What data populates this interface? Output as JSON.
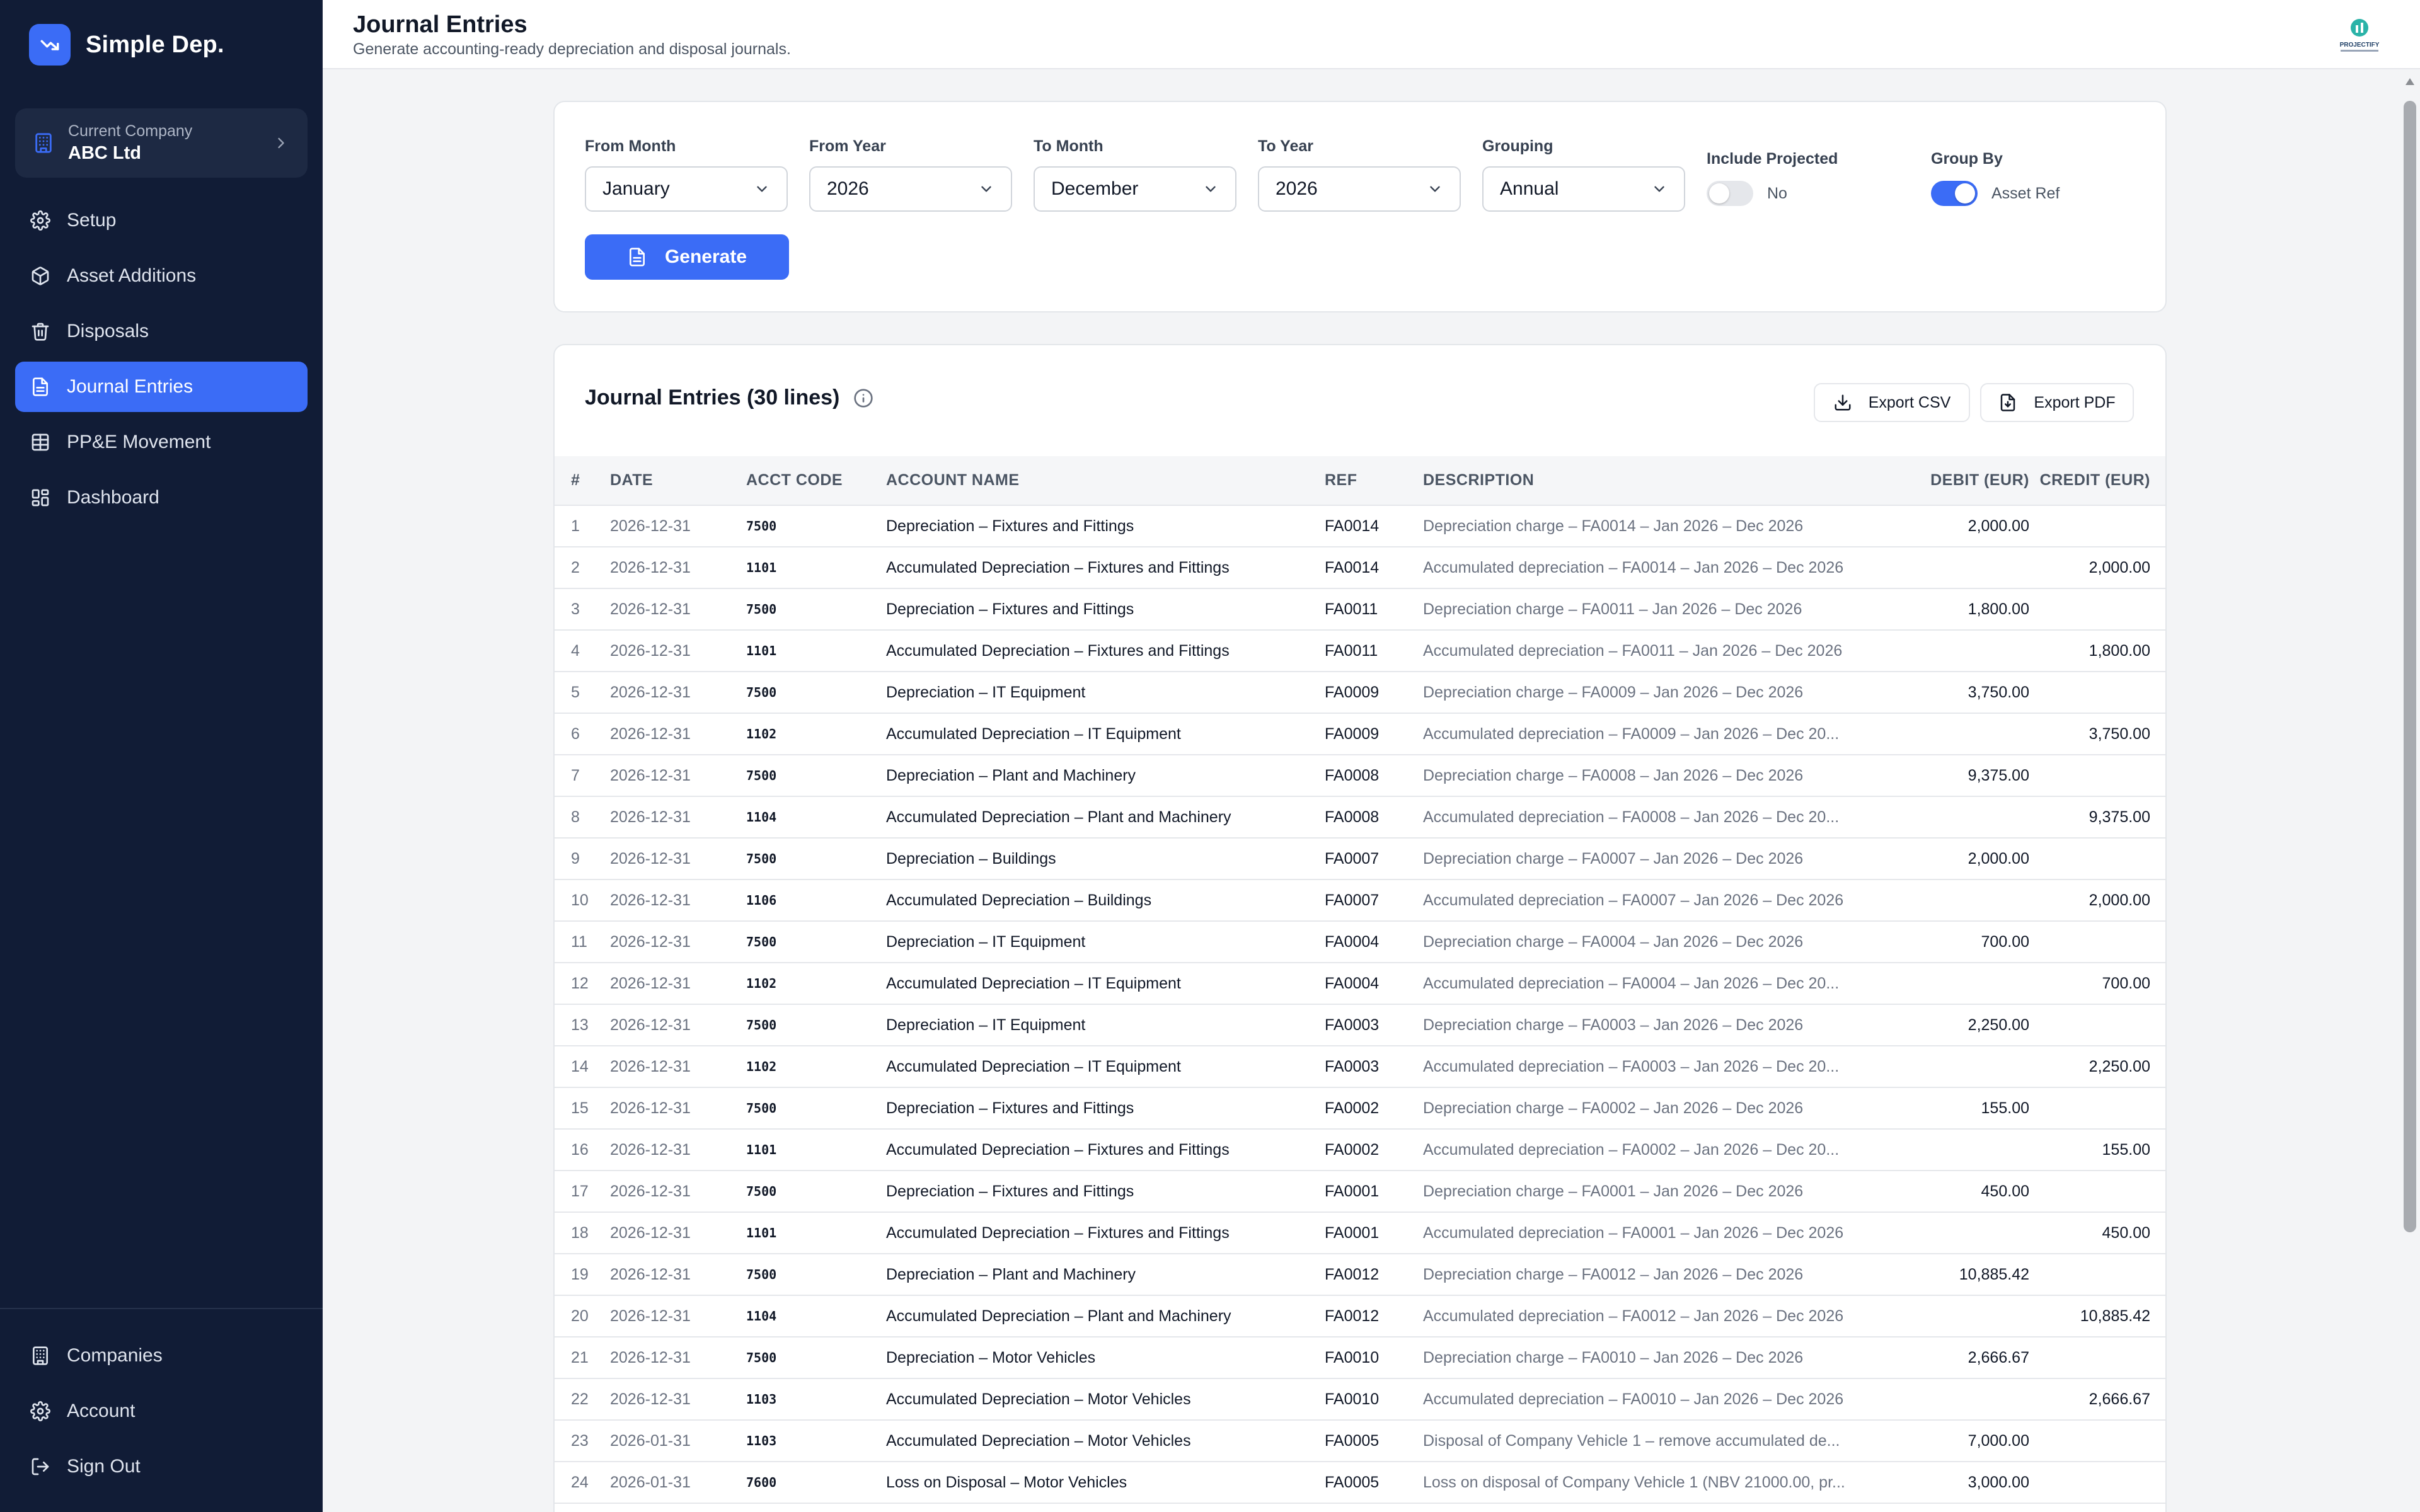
{
  "brand": {
    "name": "Simple Dep."
  },
  "company": {
    "label": "Current Company",
    "name": "ABC Ltd"
  },
  "nav": [
    {
      "label": "Setup",
      "icon": "gear-icon",
      "active": false
    },
    {
      "label": "Asset Additions",
      "icon": "package-icon",
      "active": false
    },
    {
      "label": "Disposals",
      "icon": "trash-icon",
      "active": false
    },
    {
      "label": "Journal Entries",
      "icon": "document-icon",
      "active": true
    },
    {
      "label": "PP&E Movement",
      "icon": "grid-icon",
      "active": false
    },
    {
      "label": "Dashboard",
      "icon": "dashboard-icon",
      "active": false
    }
  ],
  "nav_bottom": [
    {
      "label": "Companies",
      "icon": "building-icon"
    },
    {
      "label": "Account",
      "icon": "gear-icon"
    },
    {
      "label": "Sign Out",
      "icon": "sign-out-icon"
    }
  ],
  "header": {
    "title": "Journal Entries",
    "subtitle": "Generate accounting-ready depreciation and disposal journals.",
    "logo_text": "PROJECTIFY"
  },
  "filters": {
    "from_month": {
      "label": "From Month",
      "value": "January"
    },
    "from_year": {
      "label": "From Year",
      "value": "2026"
    },
    "to_month": {
      "label": "To Month",
      "value": "December"
    },
    "to_year": {
      "label": "To Year",
      "value": "2026"
    },
    "grouping": {
      "label": "Grouping",
      "value": "Annual"
    },
    "include_projected": {
      "label": "Include Projected",
      "value": "No",
      "on": false
    },
    "group_by": {
      "label": "Group By",
      "value": "Asset Ref",
      "on": true
    },
    "generate_label": "Generate"
  },
  "table": {
    "title": "Journal Entries (30 lines)",
    "export_csv": "Export CSV",
    "export_pdf": "Export PDF",
    "columns": [
      "#",
      "Date",
      "Acct Code",
      "Account Name",
      "Ref",
      "Description",
      "Debit (EUR)",
      "Credit (EUR)"
    ],
    "rows": [
      [
        "1",
        "2026-12-31",
        "7500",
        "Depreciation – Fixtures and Fittings",
        "FA0014",
        "Depreciation charge – FA0014 – Jan 2026 – Dec 2026",
        "2,000.00",
        ""
      ],
      [
        "2",
        "2026-12-31",
        "1101",
        "Accumulated Depreciation – Fixtures and Fittings",
        "FA0014",
        "Accumulated depreciation – FA0014 – Jan 2026 – Dec 2026",
        "",
        "2,000.00"
      ],
      [
        "3",
        "2026-12-31",
        "7500",
        "Depreciation – Fixtures and Fittings",
        "FA0011",
        "Depreciation charge – FA0011 – Jan 2026 – Dec 2026",
        "1,800.00",
        ""
      ],
      [
        "4",
        "2026-12-31",
        "1101",
        "Accumulated Depreciation – Fixtures and Fittings",
        "FA0011",
        "Accumulated depreciation – FA0011 – Jan 2026 – Dec 2026",
        "",
        "1,800.00"
      ],
      [
        "5",
        "2026-12-31",
        "7500",
        "Depreciation – IT Equipment",
        "FA0009",
        "Depreciation charge – FA0009 – Jan 2026 – Dec 2026",
        "3,750.00",
        ""
      ],
      [
        "6",
        "2026-12-31",
        "1102",
        "Accumulated Depreciation – IT Equipment",
        "FA0009",
        "Accumulated depreciation – FA0009 – Jan 2026 – Dec 20...",
        "",
        "3,750.00"
      ],
      [
        "7",
        "2026-12-31",
        "7500",
        "Depreciation – Plant and Machinery",
        "FA0008",
        "Depreciation charge – FA0008 – Jan 2026 – Dec 2026",
        "9,375.00",
        ""
      ],
      [
        "8",
        "2026-12-31",
        "1104",
        "Accumulated Depreciation – Plant and Machinery",
        "FA0008",
        "Accumulated depreciation – FA0008 – Jan 2026 – Dec 20...",
        "",
        "9,375.00"
      ],
      [
        "9",
        "2026-12-31",
        "7500",
        "Depreciation – Buildings",
        "FA0007",
        "Depreciation charge – FA0007 – Jan 2026 – Dec 2026",
        "2,000.00",
        ""
      ],
      [
        "10",
        "2026-12-31",
        "1106",
        "Accumulated Depreciation – Buildings",
        "FA0007",
        "Accumulated depreciation – FA0007 – Jan 2026 – Dec 2026",
        "",
        "2,000.00"
      ],
      [
        "11",
        "2026-12-31",
        "7500",
        "Depreciation – IT Equipment",
        "FA0004",
        "Depreciation charge – FA0004 – Jan 2026 – Dec 2026",
        "700.00",
        ""
      ],
      [
        "12",
        "2026-12-31",
        "1102",
        "Accumulated Depreciation – IT Equipment",
        "FA0004",
        "Accumulated depreciation – FA0004 – Jan 2026 – Dec 20...",
        "",
        "700.00"
      ],
      [
        "13",
        "2026-12-31",
        "7500",
        "Depreciation – IT Equipment",
        "FA0003",
        "Depreciation charge – FA0003 – Jan 2026 – Dec 2026",
        "2,250.00",
        ""
      ],
      [
        "14",
        "2026-12-31",
        "1102",
        "Accumulated Depreciation – IT Equipment",
        "FA0003",
        "Accumulated depreciation – FA0003 – Jan 2026 – Dec 20...",
        "",
        "2,250.00"
      ],
      [
        "15",
        "2026-12-31",
        "7500",
        "Depreciation – Fixtures and Fittings",
        "FA0002",
        "Depreciation charge – FA0002 – Jan 2026 – Dec 2026",
        "155.00",
        ""
      ],
      [
        "16",
        "2026-12-31",
        "1101",
        "Accumulated Depreciation – Fixtures and Fittings",
        "FA0002",
        "Accumulated depreciation – FA0002 – Jan 2026 – Dec 20...",
        "",
        "155.00"
      ],
      [
        "17",
        "2026-12-31",
        "7500",
        "Depreciation – Fixtures and Fittings",
        "FA0001",
        "Depreciation charge – FA0001 – Jan 2026 – Dec 2026",
        "450.00",
        ""
      ],
      [
        "18",
        "2026-12-31",
        "1101",
        "Accumulated Depreciation – Fixtures and Fittings",
        "FA0001",
        "Accumulated depreciation – FA0001 – Jan 2026 – Dec 2026",
        "",
        "450.00"
      ],
      [
        "19",
        "2026-12-31",
        "7500",
        "Depreciation – Plant and Machinery",
        "FA0012",
        "Depreciation charge – FA0012 – Jan 2026 – Dec 2026",
        "10,885.42",
        ""
      ],
      [
        "20",
        "2026-12-31",
        "1104",
        "Accumulated Depreciation – Plant and Machinery",
        "FA0012",
        "Accumulated depreciation – FA0012 – Jan 2026 – Dec 2026",
        "",
        "10,885.42"
      ],
      [
        "21",
        "2026-12-31",
        "7500",
        "Depreciation – Motor Vehicles",
        "FA0010",
        "Depreciation charge – FA0010 – Jan 2026 – Dec 2026",
        "2,666.67",
        ""
      ],
      [
        "22",
        "2026-12-31",
        "1103",
        "Accumulated Depreciation – Motor Vehicles",
        "FA0010",
        "Accumulated depreciation – FA0010 – Jan 2026 – Dec 2026",
        "",
        "2,666.67"
      ],
      [
        "23",
        "2026-01-31",
        "1103",
        "Accumulated Depreciation – Motor Vehicles",
        "FA0005",
        "Disposal of Company Vehicle 1 – remove accumulated de...",
        "7,000.00",
        ""
      ],
      [
        "24",
        "2026-01-31",
        "7600",
        "Loss on Disposal – Motor Vehicles",
        "FA0005",
        "Loss on disposal of Company Vehicle 1 (NBV 21000.00, pr...",
        "3,000.00",
        ""
      ]
    ]
  },
  "colors": {
    "sidebar_bg": "#111c36",
    "accent": "#3b6cf6",
    "page_bg": "#f3f4f6"
  }
}
